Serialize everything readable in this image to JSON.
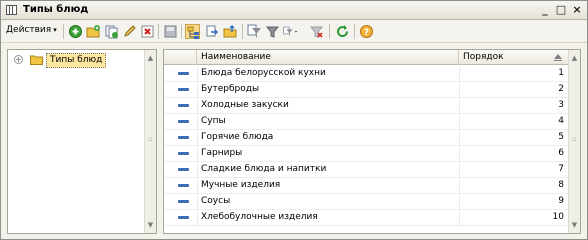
{
  "window": {
    "title": "Типы блюд",
    "minimize": "_",
    "maximize": "□",
    "close": "×"
  },
  "toolbar": {
    "actions_label": "Действия",
    "buttons": [
      "add-icon",
      "add-folder-icon",
      "copy-icon",
      "edit-icon",
      "delete-icon",
      "save-icon",
      "tree-mode-icon",
      "move-to-folder-icon",
      "up-level-icon",
      "filter-set-icon",
      "filter-icon",
      "filter-list-icon",
      "filter-clear-icon",
      "refresh-icon",
      "help-icon"
    ]
  },
  "tree": {
    "root_label": "Типы блюд",
    "expander": "+"
  },
  "grid": {
    "columns": {
      "name": "Наименование",
      "order": "Порядок"
    },
    "rows": [
      {
        "name": "Блюда белорусской кухни",
        "order": "1"
      },
      {
        "name": "Бутерброды",
        "order": "2"
      },
      {
        "name": "Холодные закуски",
        "order": "3"
      },
      {
        "name": "Супы",
        "order": "4"
      },
      {
        "name": "Горячие блюда",
        "order": "5"
      },
      {
        "name": "Гарниры",
        "order": "6"
      },
      {
        "name": "Сладкие блюда и напитки",
        "order": "7"
      },
      {
        "name": "Мучные изделия",
        "order": "8"
      },
      {
        "name": "Соусы",
        "order": "9"
      },
      {
        "name": "Хлебобулочные изделия",
        "order": "10"
      }
    ]
  },
  "colors": {
    "accent_blue": "#3d6db5",
    "tree_selection": "#fde7a0",
    "window_bg": "#f2f1ea"
  }
}
